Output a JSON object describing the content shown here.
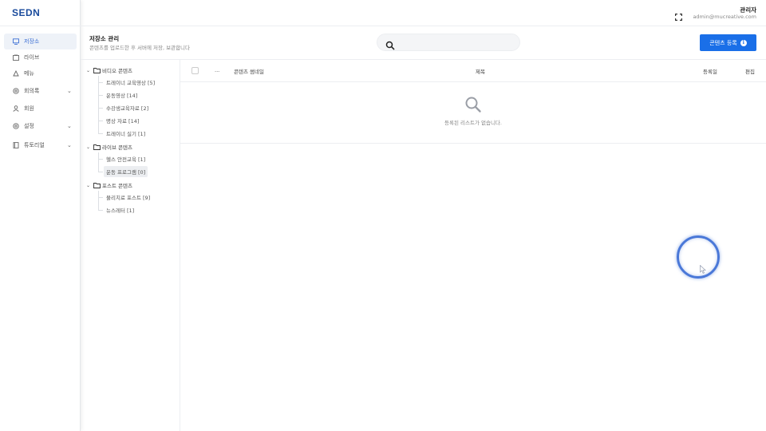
{
  "brand": {
    "logo": "SEDN"
  },
  "sidebar": {
    "items": [
      {
        "label": "저장소",
        "icon": "monitor-icon",
        "active": true,
        "expandable": false
      },
      {
        "label": "라이브",
        "icon": "live-icon",
        "active": false,
        "expandable": false
      },
      {
        "label": "메뉴",
        "icon": "menu-icon",
        "active": false,
        "expandable": false
      },
      {
        "label": "회의록",
        "icon": "settings-icon",
        "active": false,
        "expandable": true
      },
      {
        "label": "회원",
        "icon": "user-icon",
        "active": false,
        "expandable": false
      },
      {
        "label": "설정",
        "icon": "settings-icon",
        "active": false,
        "expandable": true
      },
      {
        "label": "튜토리얼",
        "icon": "book-icon",
        "active": false,
        "expandable": true
      }
    ]
  },
  "header": {
    "user_name": "관리자",
    "user_email": "admin@mucreative.com"
  },
  "page": {
    "title": "저장소 관리",
    "subtitle": "콘텐츠를 업로드한 후 서버에 저장, 보관합니다",
    "search_placeholder": "",
    "register_button": "콘텐츠 등록",
    "accent_color": "#1a6fe8"
  },
  "tree": {
    "folders": [
      {
        "label": "비디오 콘텐츠",
        "children": [
          "트레이너 교육영상 [5]",
          "운동영상 [14]",
          "수강생교육자료 [2]",
          "명상 자료 [14]",
          "트레이너 실기 [1]"
        ]
      },
      {
        "label": "라이브 콘텐츠",
        "children": [
          "헬스 안전교육 [1]",
          "운동 프로그램 [0]"
        ]
      },
      {
        "label": "포스트 콘텐츠",
        "children": [
          "물리치료 포스트 [9]",
          "뉴스레터 [1]"
        ]
      }
    ],
    "selected": "운동 프로그램 [0]"
  },
  "table": {
    "columns": {
      "more": "...",
      "thumbnail": "콘텐츠 썸네일",
      "title": "제목",
      "date": "등록일",
      "edit": "편집"
    },
    "empty_message": "등록된 리스트가 없습니다."
  }
}
